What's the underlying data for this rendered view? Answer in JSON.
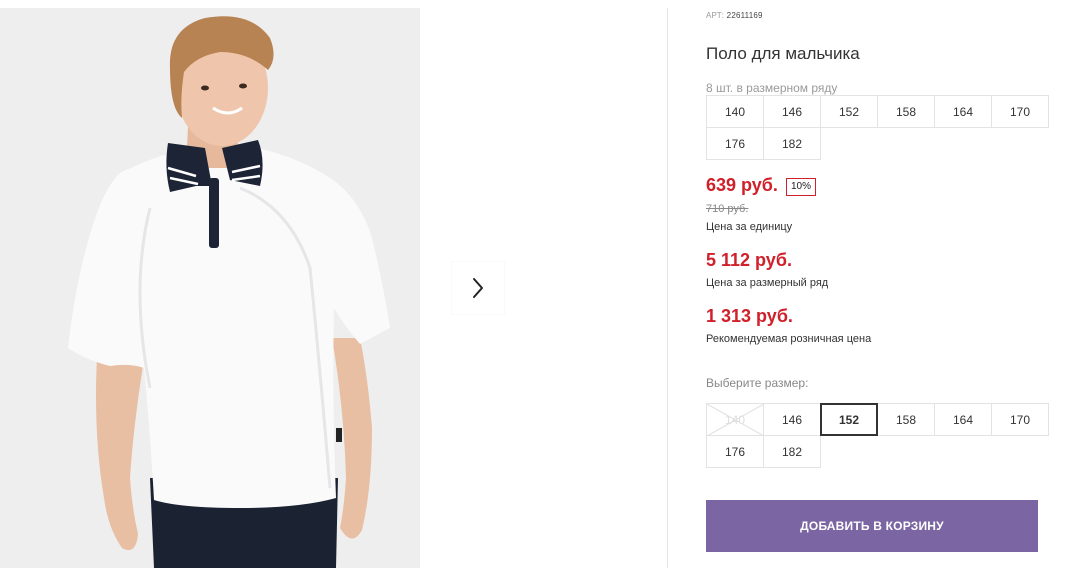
{
  "product": {
    "art_label": "АРТ:",
    "art_value": "22611169",
    "title": "Поло для мальчика",
    "range_label": "8 шт. в размерном ряду",
    "range_sizes": [
      "140",
      "146",
      "152",
      "158",
      "164",
      "170",
      "176",
      "182"
    ]
  },
  "pricing": {
    "price": "639 руб.",
    "discount": "10%",
    "old_price": "710 руб.",
    "unit_label": "Цена за единицу",
    "range_price": "5 112 руб.",
    "range_price_label": "Цена за размерный ряд",
    "retail_price": "1 313 руб.",
    "retail_label": "Рекомендуемая розничная цена"
  },
  "size_select": {
    "label": "Выберите размер:",
    "sizes": [
      {
        "value": "140",
        "state": "disabled"
      },
      {
        "value": "146",
        "state": "available"
      },
      {
        "value": "152",
        "state": "selected"
      },
      {
        "value": "158",
        "state": "available"
      },
      {
        "value": "164",
        "state": "available"
      },
      {
        "value": "170",
        "state": "available"
      },
      {
        "value": "176",
        "state": "available"
      },
      {
        "value": "182",
        "state": "available"
      }
    ]
  },
  "actions": {
    "add_to_cart": "ДОБАВИТЬ В КОРЗИНУ"
  },
  "gallery": {
    "next_icon": "chevron-right-icon",
    "photo": "boy-in-white-polo-photo"
  },
  "colors": {
    "price_red": "#d0202a",
    "button_purple": "#7b66a3",
    "photo_bg": "#eeeeef"
  }
}
